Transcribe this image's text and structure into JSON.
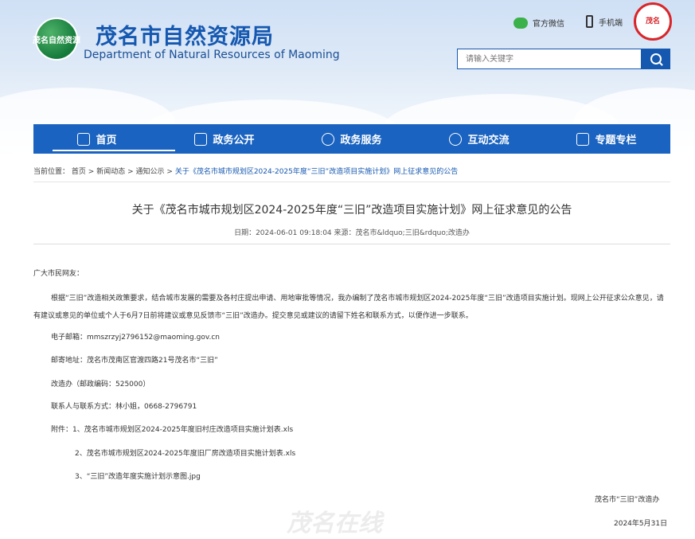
{
  "header": {
    "logo_text": "茂名自然资源",
    "title": "茂名市自然资源局",
    "subtitle": "Department of Natural Resources of Maoming",
    "links": [
      {
        "label": "官方微信",
        "icon": "wechat-icon"
      },
      {
        "label": "手机端",
        "icon": "mobile-phone-icon"
      }
    ],
    "seal_text": "茂名",
    "search": {
      "placeholder": "请输入关键字"
    }
  },
  "nav": [
    {
      "label": "首页",
      "icon": "home-icon",
      "active": true
    },
    {
      "label": "政务公开",
      "icon": "document-icon"
    },
    {
      "label": "政务服务",
      "icon": "service-icon"
    },
    {
      "label": "互动交流",
      "icon": "chat-icon"
    },
    {
      "label": "专题专栏",
      "icon": "trophy-icon"
    }
  ],
  "breadcrumb": {
    "prefix": "当前位置：",
    "items": [
      "首页",
      "新闻动态",
      "通知公示"
    ],
    "sep": ">",
    "current": "关于《茂名市城市规划区2024-2025年度“三旧”改造项目实施计划》网上征求意见的公告"
  },
  "article": {
    "title": "关于《茂名市城市规划区2024-2025年度“三旧”改造项目实施计划》网上征求意见的公告",
    "meta": "日期：2024-06-01 09:18:04   来源：茂名市&ldquo;三旧&rdquo;改造办",
    "greeting": "广大市民网友：",
    "body": "根据“三旧”改造相关政策要求，结合城市发展的需要及各村庄提出申请、用地审批等情况，我办编制了茂名市城市规划区2024-2025年度“三旧”改造项目实施计划。现网上公开征求公众意见，请有建议或意见的单位或个人于6月7日前将建议或意见反馈市“三旧”改造办。提交意见或建议的请留下姓名和联系方式，以便作进一步联系。",
    "email": "电子邮箱：mmszrzyj2796152@maoming.gov.cn",
    "address": "邮寄地址：茂名市茂南区官渡四路21号茂名市“三旧”",
    "office": "改造办（邮政编码：525000）",
    "contact": "联系人与联系方式：林小姐，0668-2796791",
    "attachments": [
      "附件：1、茂名市城市规划区2024-2025年度旧村庄改造项目实施计划表.xls",
      "2、茂名市城市规划区2024-2025年度旧厂房改造项目实施计划表.xls",
      "3、“三旧”改造年度实施计划示意图.jpg"
    ],
    "signature": "茂名市“三旧”改造办",
    "date": "2024年5月31日"
  },
  "watermark": "茂名在线"
}
